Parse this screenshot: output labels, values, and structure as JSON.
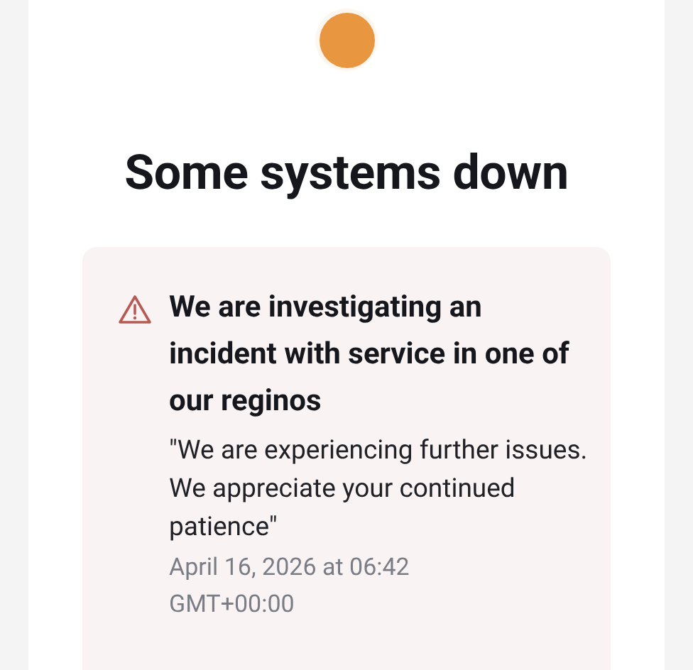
{
  "status": {
    "kind": "partial_outage",
    "title": "Some systems down"
  },
  "incident": {
    "title": "We are investigating an incident with service in one of our reginos",
    "message": "\"We are experiencing further issues. We appreciate your continued patience\"",
    "timestamp": "April 16, 2026 at 06:42 GMT+00:00"
  }
}
